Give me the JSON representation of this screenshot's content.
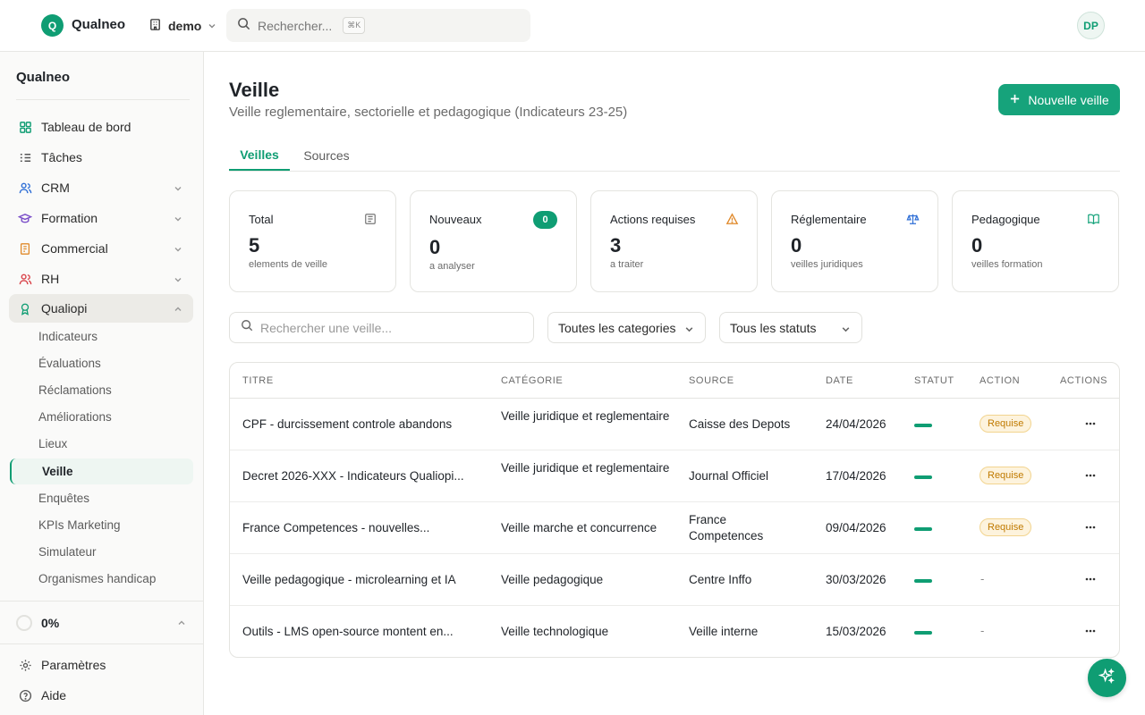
{
  "app": {
    "logo_letter": "Q",
    "name": "Qualneo"
  },
  "org": {
    "name": "demo",
    "icon": "building-icon"
  },
  "top_search": {
    "placeholder": "Rechercher...",
    "shortcut": "⌘K"
  },
  "user": {
    "initials": "DP"
  },
  "sidebar": {
    "title": "Qualneo",
    "items": [
      {
        "label": "Tableau de bord",
        "icon": "dashboard-icon",
        "color": "#0f9d73"
      },
      {
        "label": "Tâches",
        "icon": "tasks-list-icon",
        "color": "#555555"
      },
      {
        "label": "CRM",
        "icon": "users-icon",
        "color": "#2f6fd6"
      },
      {
        "label": "Formation",
        "icon": "graduation-cap-icon",
        "color": "#7b4fc9"
      },
      {
        "label": "Commercial",
        "icon": "invoice-icon",
        "color": "#e0892a"
      },
      {
        "label": "RH",
        "icon": "people-icon",
        "color": "#d9434a"
      },
      {
        "label": "Qualiopi",
        "icon": "award-icon",
        "color": "#0f9d73"
      }
    ],
    "qualiopi_sub": [
      "Indicateurs",
      "Évaluations",
      "Réclamations",
      "Améliorations",
      "Lieux",
      "Veille",
      "Enquêtes",
      "KPIs Marketing",
      "Simulateur",
      "Organismes handicap"
    ],
    "progress": "0%",
    "footer": [
      {
        "label": "Paramètres",
        "icon": "gear-icon"
      },
      {
        "label": "Aide",
        "icon": "help-circle-icon"
      }
    ]
  },
  "page": {
    "title": "Veille",
    "subtitle": "Veille reglementaire, sectorielle et pedagogique (Indicateurs 23-25)",
    "new_button": "Nouvelle veille"
  },
  "tabs": [
    "Veilles",
    "Sources"
  ],
  "stats": [
    {
      "label": "Total",
      "value": "5",
      "sub": "elements de veille",
      "icon": "newspaper-icon"
    },
    {
      "label": "Nouveaux",
      "value": "0",
      "sub": "a analyser",
      "badge": "0"
    },
    {
      "label": "Actions requises",
      "value": "3",
      "sub": "a traiter",
      "icon": "warning-icon"
    },
    {
      "label": "Réglementaire",
      "value": "0",
      "sub": "veilles juridiques",
      "icon": "scale-icon"
    },
    {
      "label": "Pedagogique",
      "value": "0",
      "sub": "veilles formation",
      "icon": "book-icon"
    }
  ],
  "filters": {
    "search_placeholder": "Rechercher une veille...",
    "category": "Toutes les categories",
    "status": "Tous les statuts"
  },
  "table": {
    "headers": [
      "TITRE",
      "CATÉGORIE",
      "SOURCE",
      "DATE",
      "STATUT",
      "ACTION",
      "ACTIONS"
    ],
    "rows": [
      {
        "title": "CPF - durcissement controle abandons",
        "category": "Veille juridique et reglementaire",
        "source": "Caisse des Depots",
        "date": "24/04/2026",
        "action": "Requise"
      },
      {
        "title": "Decret 2026-XXX - Indicateurs Qualiopi...",
        "category": "Veille juridique et reglementaire",
        "source": "Journal Officiel",
        "date": "17/04/2026",
        "action": "Requise"
      },
      {
        "title": "France Competences - nouvelles...",
        "category": "Veille marche et concurrence",
        "source": "France Competences",
        "date": "09/04/2026",
        "action": "Requise"
      },
      {
        "title": "Veille pedagogique - microlearning et IA",
        "category": "Veille pedagogique",
        "source": "Centre Inffo",
        "date": "30/03/2026",
        "action": "-"
      },
      {
        "title": "Outils - LMS open-source montent en...",
        "category": "Veille technologique",
        "source": "Veille interne",
        "date": "15/03/2026",
        "action": "-"
      }
    ]
  },
  "colors": {
    "accent": "#0f9d73",
    "warning": "#e0892a",
    "pill_bg": "#fdf3dd"
  }
}
